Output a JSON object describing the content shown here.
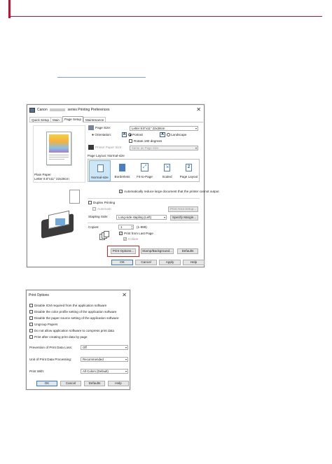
{
  "pref": {
    "title_left": "Canon",
    "title_right": "series Printing Preferences",
    "tabs": [
      "Quick Setup",
      "Main",
      "Page Setup",
      "Maintenance"
    ],
    "preview_media": "Plain Paper",
    "preview_size": "Letter 8.5\"x11\" 22x28cm",
    "page_size_label": "Page Size:",
    "page_size_value": "Letter 8.5\"x11\" 22x28cm",
    "orientation_label": "Orientation:",
    "orientation_options": [
      "Portrait",
      "Landscape"
    ],
    "orientation_selected": "Portrait",
    "rotate_label": "Rotate 180 degrees",
    "printer_paper_label": "Printer Paper Size:",
    "printer_paper_value": "Same as Page Size",
    "layout_label": "Page Layout: Normal-size",
    "layouts": [
      "Normal-size",
      "Borderless",
      "Fit-to-Page",
      "Scaled",
      "Page Layout"
    ],
    "auto_reduce_label": "Automatically reduce large document that the printer cannot output",
    "duplex_label": "Duplex Printing",
    "automatic_label": "Automatic",
    "print_area_btn": "Print Area Setup...",
    "stapling_label": "Stapling Side:",
    "stapling_value": "Long-side stapling (Left)",
    "specify_margin_btn": "Specify Margin...",
    "copies_label": "Copies:",
    "copies_value": "1",
    "copies_range": "(1-999)",
    "last_page_label": "Print from Last Page",
    "collate_label": "Collate",
    "print_options_btn": "Print Options...",
    "stamp_btn": "Stamp/Background...",
    "defaults_btn": "Defaults",
    "ok_btn": "OK",
    "cancel_btn": "Cancel",
    "apply_btn": "Apply",
    "help_btn": "Help",
    "highlight_color": "#e02020"
  },
  "opts": {
    "title": "Print Options",
    "checks": [
      "Disable ICM required from the application software",
      "Disable the color profile setting of the application software",
      "Disable the paper source setting of the application software",
      "Ungroup Papers",
      "Do not allow application software to compress print data",
      "Print after creating print data by page"
    ],
    "prevention_label": "Prevention of Print Data Loss:",
    "prevention_value": "Off",
    "unit_label": "Unit of Print Data Processing:",
    "unit_value": "Recommended",
    "print_with_label": "Print With:",
    "print_with_value": "All Colors (Default)",
    "ok_btn": "OK",
    "cancel_btn": "Cancel",
    "defaults_btn": "Defaults",
    "help_btn": "Help"
  }
}
